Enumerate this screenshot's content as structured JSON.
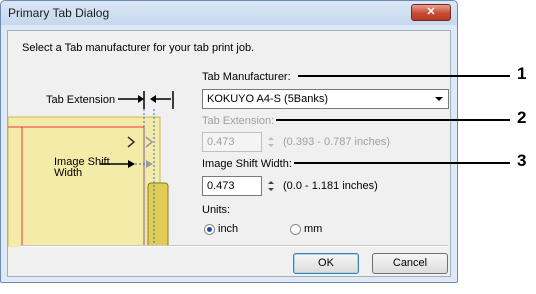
{
  "dialog": {
    "title": "Primary Tab Dialog",
    "close_label": "✕",
    "instruction": "Select a Tab manufacturer for your tab print job."
  },
  "tab_manufacturer": {
    "label": "Tab Manufacturer:",
    "selected": "KOKUYO A4-S (5Banks)"
  },
  "tab_extension": {
    "label": "Tab Extension:",
    "value": "0.473",
    "range": "(0.393 - 0.787 inches)",
    "enabled": false
  },
  "image_shift_width": {
    "label": "Image Shift Width:",
    "value": "0.473",
    "range": "(0.0 - 1.181 inches)"
  },
  "units": {
    "label": "Units:",
    "options": [
      "inch",
      "mm"
    ],
    "selected": "inch"
  },
  "buttons": {
    "ok": "OK",
    "cancel": "Cancel"
  },
  "illustration": {
    "tab_extension_label": "Tab Extension",
    "image_shift_line1": "Image Shift",
    "image_shift_line2": "Width"
  },
  "callouts": [
    "1",
    "2",
    "3"
  ],
  "colors": {
    "paper_tab": "#f2e89a",
    "tab_edge": "#d4c33a",
    "margin_line": "#e23b3b",
    "guide_line": "#2a6fd6"
  }
}
